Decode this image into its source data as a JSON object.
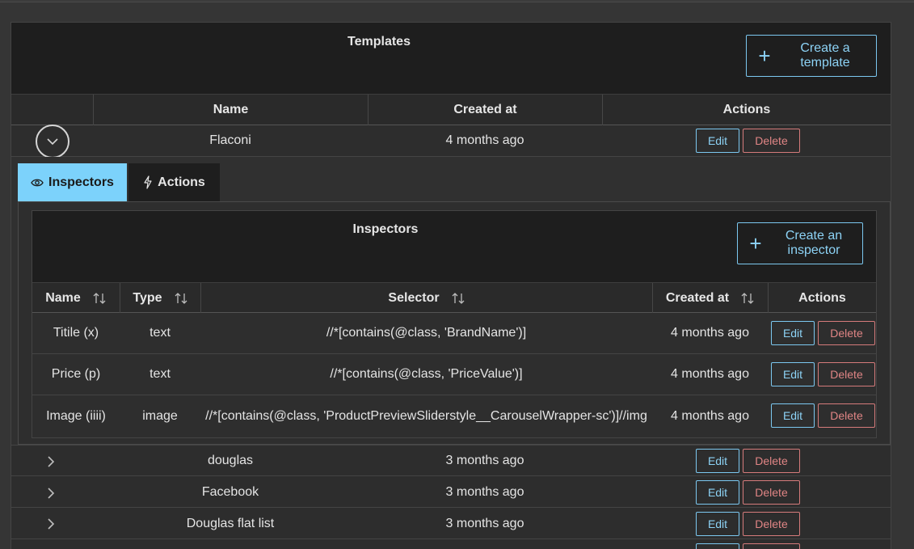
{
  "templates": {
    "title": "Templates",
    "create_label": "Create a template",
    "columns": {
      "name": "Name",
      "created_at": "Created at",
      "actions": "Actions"
    },
    "rows": [
      {
        "name": "Flaconi",
        "created": "4 months ago",
        "edit": "Edit",
        "delete": "Delete"
      },
      {
        "name": "douglas",
        "created": "3 months ago",
        "edit": "Edit",
        "delete": "Delete"
      },
      {
        "name": "Facebook",
        "created": "3 months ago",
        "edit": "Edit",
        "delete": "Delete"
      },
      {
        "name": "Douglas flat list",
        "created": "3 months ago",
        "edit": "Edit",
        "delete": "Delete"
      }
    ]
  },
  "tabs": [
    {
      "label": "Inspectors",
      "icon": "eye-icon",
      "active": true
    },
    {
      "label": "Actions",
      "icon": "lightning-icon",
      "active": false
    }
  ],
  "inspectors": {
    "title": "Inspectors",
    "create_label": "Create an inspector",
    "columns": {
      "name": "Name",
      "type": "Type",
      "selector": "Selector",
      "created_at": "Created at",
      "actions": "Actions"
    },
    "rows": [
      {
        "name": "Titile (x)",
        "type": "text",
        "selector": "//*[contains(@class, 'BrandName')]",
        "created": "4 months ago",
        "edit": "Edit",
        "delete": "Delete"
      },
      {
        "name": "Price (p)",
        "type": "text",
        "selector": "//*[contains(@class, 'PriceValue')]",
        "created": "4 months ago",
        "edit": "Edit",
        "delete": "Delete"
      },
      {
        "name": "Image (iiii)",
        "type": "image",
        "selector": "//*[contains(@class, 'ProductPreviewSliderstyle__CarouselWrapper-sc')]//img",
        "created": "4 months ago",
        "edit": "Edit",
        "delete": "Delete"
      }
    ]
  },
  "colors": {
    "accent": "#7cd2fb",
    "danger": "#e08585",
    "panel_header": "#1e1e1e"
  }
}
